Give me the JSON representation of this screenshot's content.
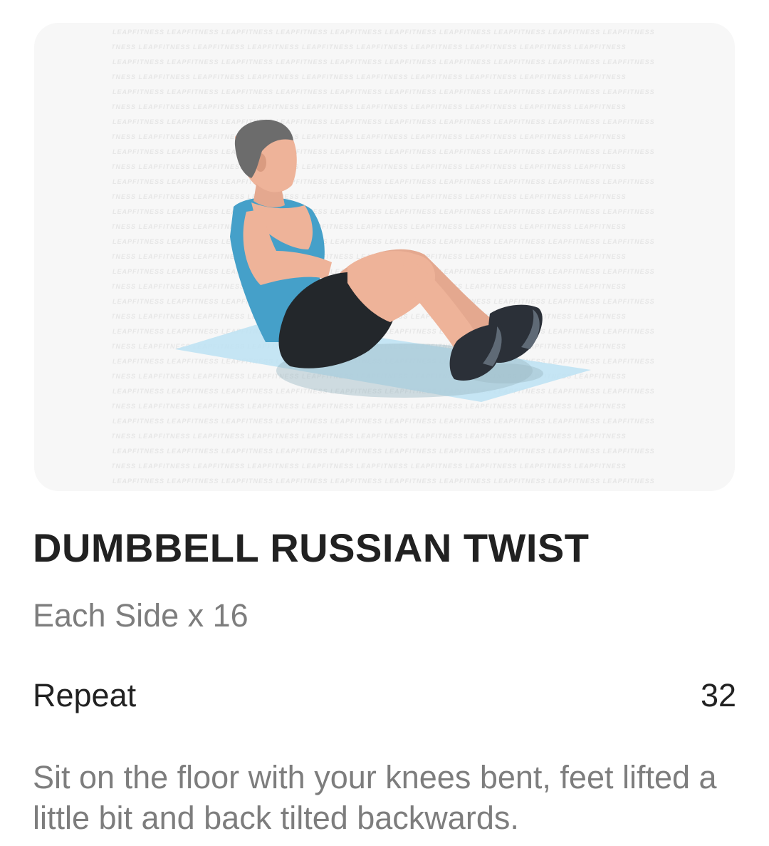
{
  "exercise": {
    "title": "DUMBBELL RUSSIAN TWIST",
    "reps": "Each Side x 16",
    "repeat_label": "Repeat",
    "repeat_value": "32",
    "description": "Sit on the floor with your knees bent, feet lifted a little bit and back tilted backwards."
  },
  "illustration": {
    "watermark_text": "LEAPFITNESS",
    "figure_icon": "person-russian-twist-illustration",
    "colors": {
      "card_background": "#f7f7f7",
      "mat": "#bfe2f3",
      "tank_top": "#45a0c9",
      "shorts": "#23272b",
      "skin": "#eeb399",
      "hair": "#6c6c6c",
      "shoes": "#2b3038"
    }
  }
}
